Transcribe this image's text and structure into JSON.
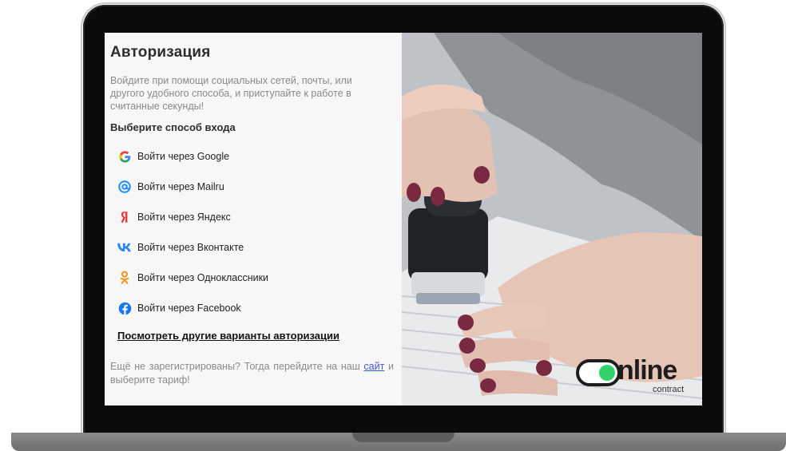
{
  "login": {
    "title": "Авторизация",
    "description": "Войдите при помощи социальных сетей, почты, или другого удобного способа, и приступайте к работе в считанные секунды!",
    "subtitle": "Выберите способ входа",
    "providers": [
      {
        "label": "Войти через Google",
        "icon": "google-icon"
      },
      {
        "label": "Войти через Mailru",
        "icon": "mailru-icon"
      },
      {
        "label": "Войти через Яндекс",
        "icon": "yandex-icon"
      },
      {
        "label": "Войти через Вконтакте",
        "icon": "vk-icon"
      },
      {
        "label": "Войти через Одноклассники",
        "icon": "odnoklassniki-icon"
      },
      {
        "label": "Войти через Facebook",
        "icon": "facebook-icon"
      }
    ],
    "more_link": "Посмотреть другие варианты авторизации",
    "footer_before": "Ещё не зарегистрированы? Тогда перейдите на наш ",
    "footer_link": "сайт",
    "footer_after": " и выберите тариф!"
  },
  "logo": {
    "wordmark": "nline",
    "sub": "contract",
    "accent": "#2fd36a"
  },
  "colors": {
    "panel_bg": "#f7f7f8",
    "text_muted": "#8a8a8a",
    "link": "#3a5bd9",
    "frame": "#0b0b0b"
  }
}
